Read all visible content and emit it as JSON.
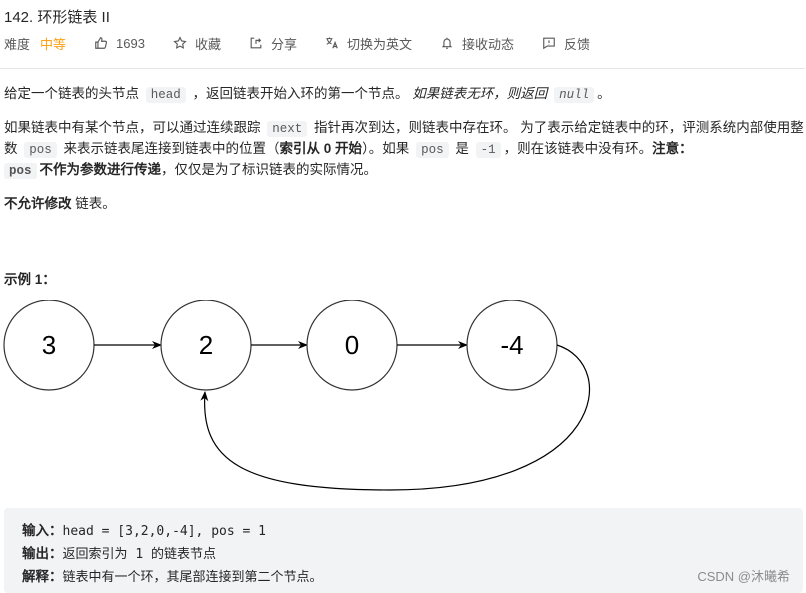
{
  "title": "142. 环形链表 II",
  "toolbar": {
    "difficulty_label": "难度",
    "difficulty_value": "中等",
    "difficulty_color": "#ffa116",
    "likes": "1693",
    "favorite": "收藏",
    "share": "分享",
    "switch_lang": "切换为英文",
    "subscribe": "接收动态",
    "feedback": "反馈",
    "icons": [
      "thumbs-up-icon",
      "star-icon",
      "share-icon",
      "translate-icon",
      "bell-icon",
      "feedback-icon"
    ]
  },
  "description": {
    "p1": {
      "t1": "给定一个链表的头节点 ",
      "c1": "head",
      "t2": " ，返回链表开始入环的第一个节点。 ",
      "i1": "如果链表无环，则返回 ",
      "c2": "null",
      "t3": "。"
    },
    "p2": {
      "t1": "如果链表中有某个节点，可以通过连续跟踪 ",
      "c1": "next",
      "t2": " 指针再次到达，则链表中存在环。 为了表示给定链表中的环，评测系统内部使用整数 ",
      "c2": "pos",
      "t3": " 来表示链表尾连接到链表中的位置（",
      "b1": "索引从 0 开始",
      "t4": "）。如果 ",
      "c3": "pos",
      "t5": " 是 ",
      "c4": "-1",
      "t6": "，则在该链表中没有环。",
      "b2": "注意：",
      "c5": "pos",
      "b3": "不作为参数进行传递",
      "t7": "，仅仅是为了标识链表的实际情况。"
    },
    "p3": {
      "b1": "不允许修改",
      "t1": " 链表。"
    }
  },
  "example": {
    "title": "示例 1：",
    "diagram": {
      "nodes": [
        "3",
        "2",
        "0",
        "-4"
      ],
      "cycle_from_index": 3,
      "cycle_to_index": 1
    },
    "input_label": "输入：",
    "input_value": "head = [3,2,0,-4], pos = 1",
    "output_label": "输出：",
    "output_value": "返回索引为 1 的链表节点",
    "explain_label": "解释：",
    "explain_value": "链表中有一个环，其尾部连接到第二个节点。"
  },
  "watermark": "CSDN @沐曦希"
}
